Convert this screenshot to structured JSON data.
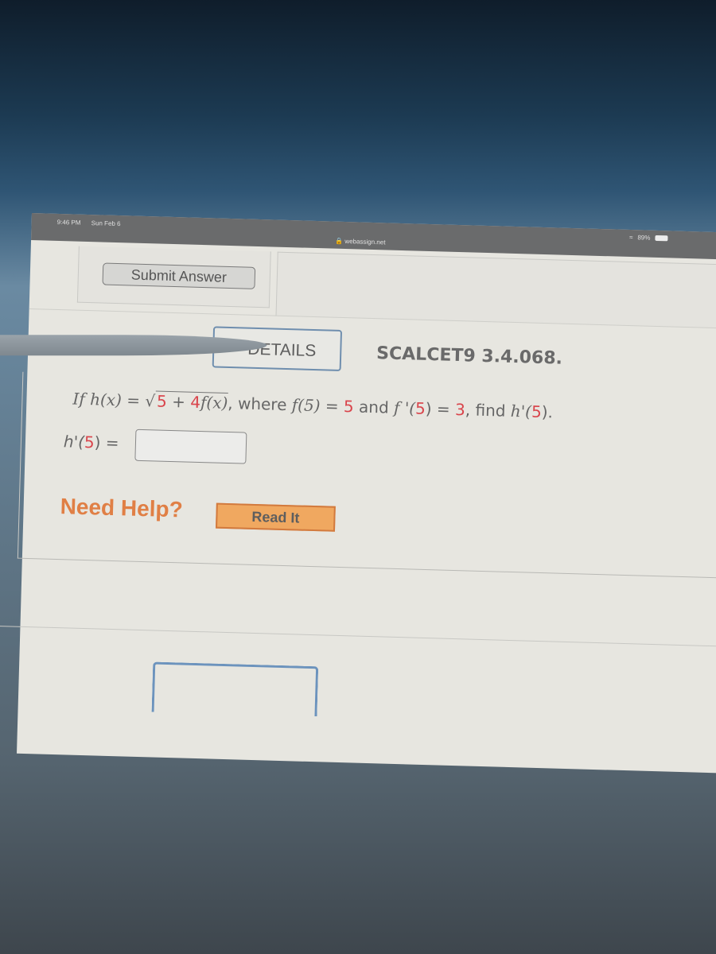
{
  "status_bar": {
    "time": "9:46 PM",
    "date": "Sun Feb 6",
    "url": "webassign.net",
    "battery": "89%"
  },
  "buttons": {
    "submit_answer": "Submit Answer",
    "details": "DETAILS",
    "read_it": "Read It"
  },
  "problem": {
    "id": "SCALCET9 3.4.068.",
    "prefix": "If",
    "h_def": "h(x) =",
    "sqrt_content_a": "5",
    "sqrt_plus": " + ",
    "sqrt_content_b": "4",
    "sqrt_fx": "f(x)",
    "where": ", where",
    "f5": "f(5)",
    "eq1": " = ",
    "f5_val": "5",
    "and": " and ",
    "fp5": "f '(",
    "fp5_arg": "5",
    "fp5_close": ")",
    "eq2": " = ",
    "fp5_val": "3",
    "find": ", find",
    "hp5": " h'(",
    "hp5_arg": "5",
    "hp5_close": ").",
    "answer_label_a": "h'(",
    "answer_label_arg": "5",
    "answer_label_b": ") =",
    "answer_value": ""
  },
  "help": {
    "label": "Need Help?"
  },
  "colors": {
    "accent_red": "#d9444b",
    "help_orange": "#e07f45",
    "read_it_bg": "#f0a860",
    "details_border": "#6f8eae"
  }
}
